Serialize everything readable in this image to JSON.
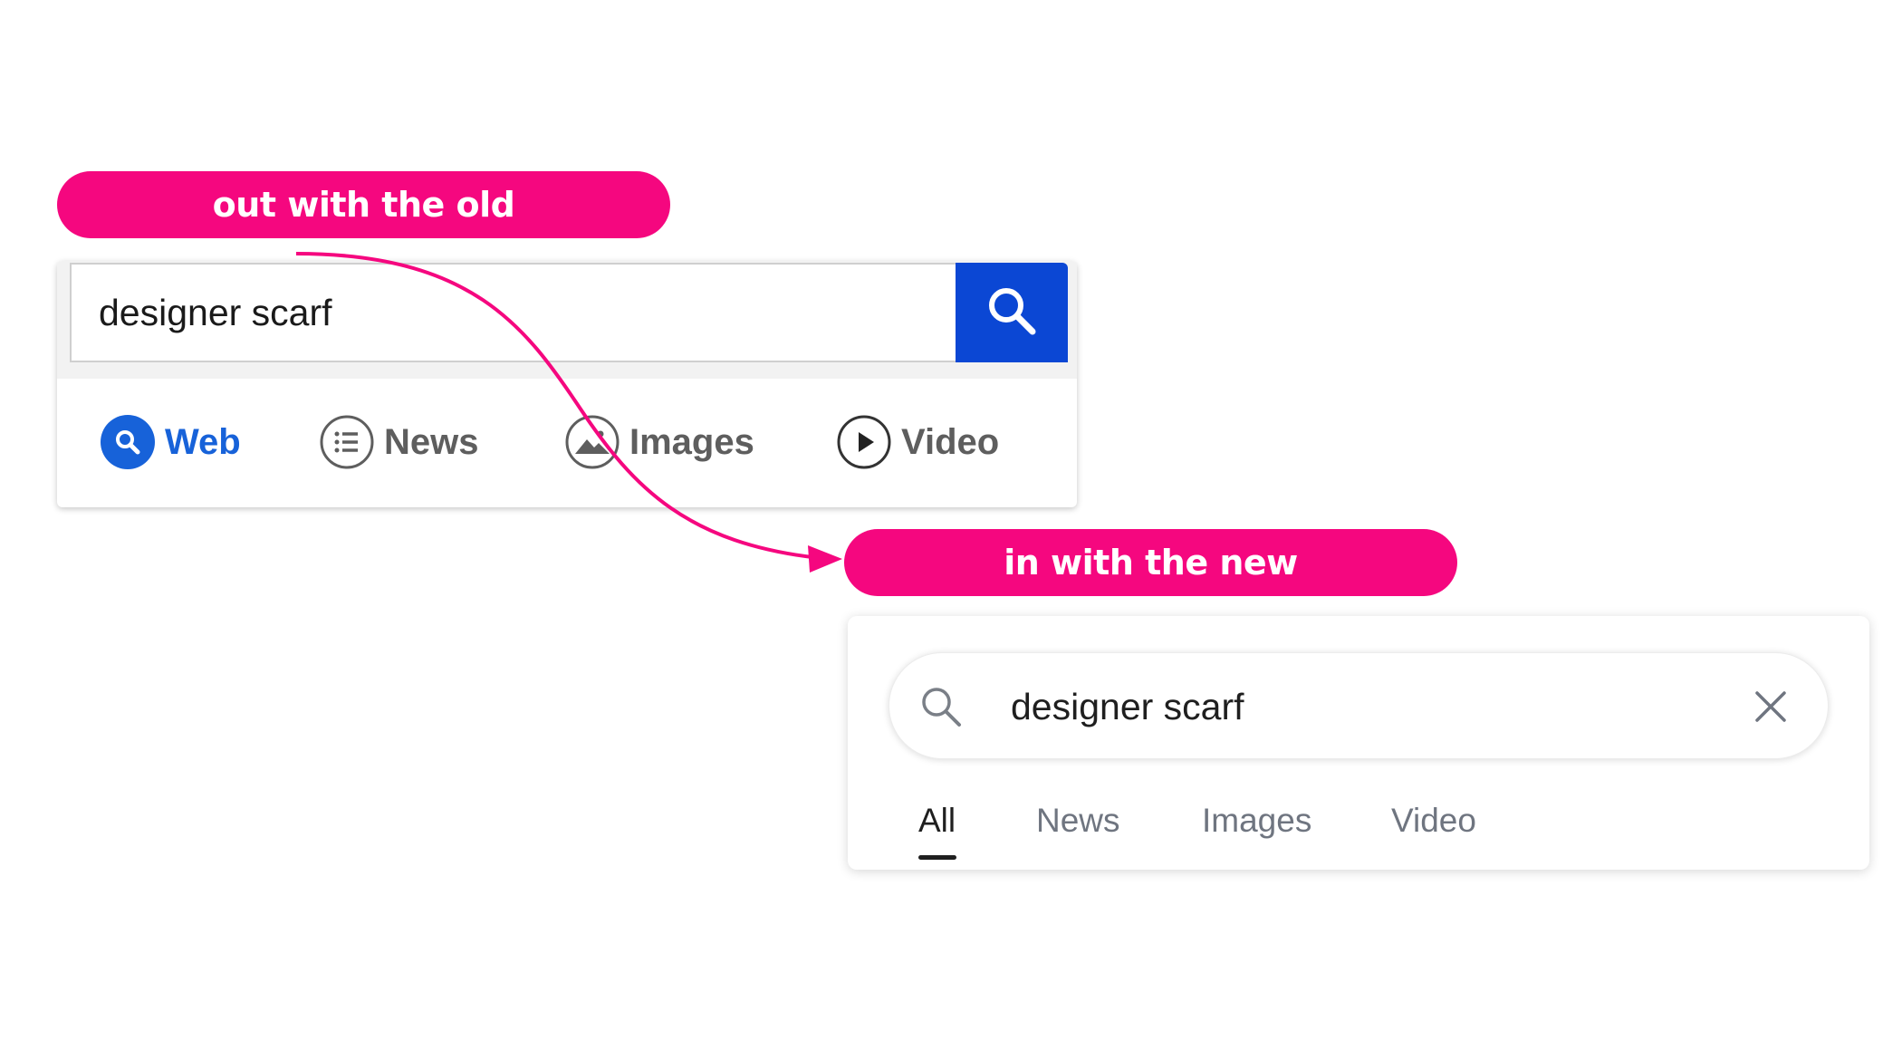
{
  "callouts": {
    "old_label": "out with the old",
    "new_label": "in with the new"
  },
  "colors": {
    "accent_pink": "#f5077f",
    "old_search_blue": "#0b47d4",
    "old_active_tab": "#1762d9",
    "new_active_text": "#1f1f1f",
    "new_inactive_text": "#6f7580"
  },
  "old_search": {
    "query": "designer scarf",
    "search_button_icon": "magnifier-icon",
    "tabs": [
      {
        "label": "Web",
        "icon": "web-search-icon",
        "active": true
      },
      {
        "label": "News",
        "icon": "news-list-icon",
        "active": false
      },
      {
        "label": "Images",
        "icon": "image-icon",
        "active": false
      },
      {
        "label": "Video",
        "icon": "play-icon",
        "active": false
      }
    ]
  },
  "new_search": {
    "query": "designer scarf",
    "search_icon": "search-icon",
    "clear_icon": "close-icon",
    "tabs": [
      {
        "label": "All",
        "active": true
      },
      {
        "label": "News",
        "active": false
      },
      {
        "label": "Images",
        "active": false
      },
      {
        "label": "Video",
        "active": false
      }
    ]
  }
}
